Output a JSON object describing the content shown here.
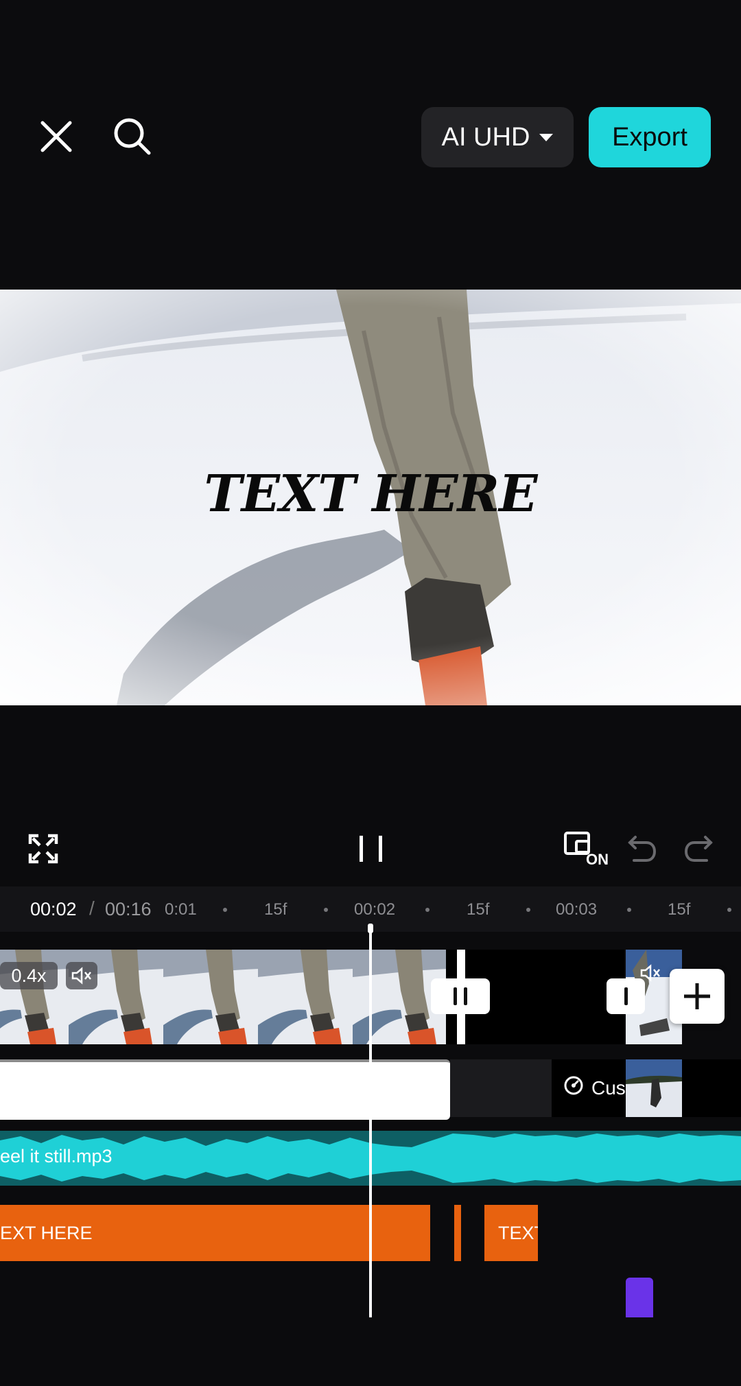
{
  "header": {
    "quality_label": "AI UHD",
    "export_label": "Export",
    "accent": "#1fd6db"
  },
  "preview": {
    "overlay_text": "TEXT HERE"
  },
  "controls": {
    "fullscreen_icon": "expand-icon",
    "play_state": "paused",
    "keyframe_badge": "ON",
    "undo_icon": "undo-icon",
    "redo_icon": "redo-icon"
  },
  "timeline": {
    "current_time": "00:02",
    "separator": "/",
    "total_time": "00:16",
    "ruler_ticks": [
      "0:01",
      "15f",
      "00:02",
      "15f",
      "00:03",
      "15f"
    ],
    "speed_label": "0.4x",
    "text_track_partial": "Cus",
    "audio_clip_name": "eel it still.mp3",
    "text_clip_1": "EXT HERE",
    "text_clip_2": "TEXT",
    "text_clip_color": "#e8620f",
    "audio_color": "#1fd0d6",
    "add_icon": "plus-icon"
  }
}
